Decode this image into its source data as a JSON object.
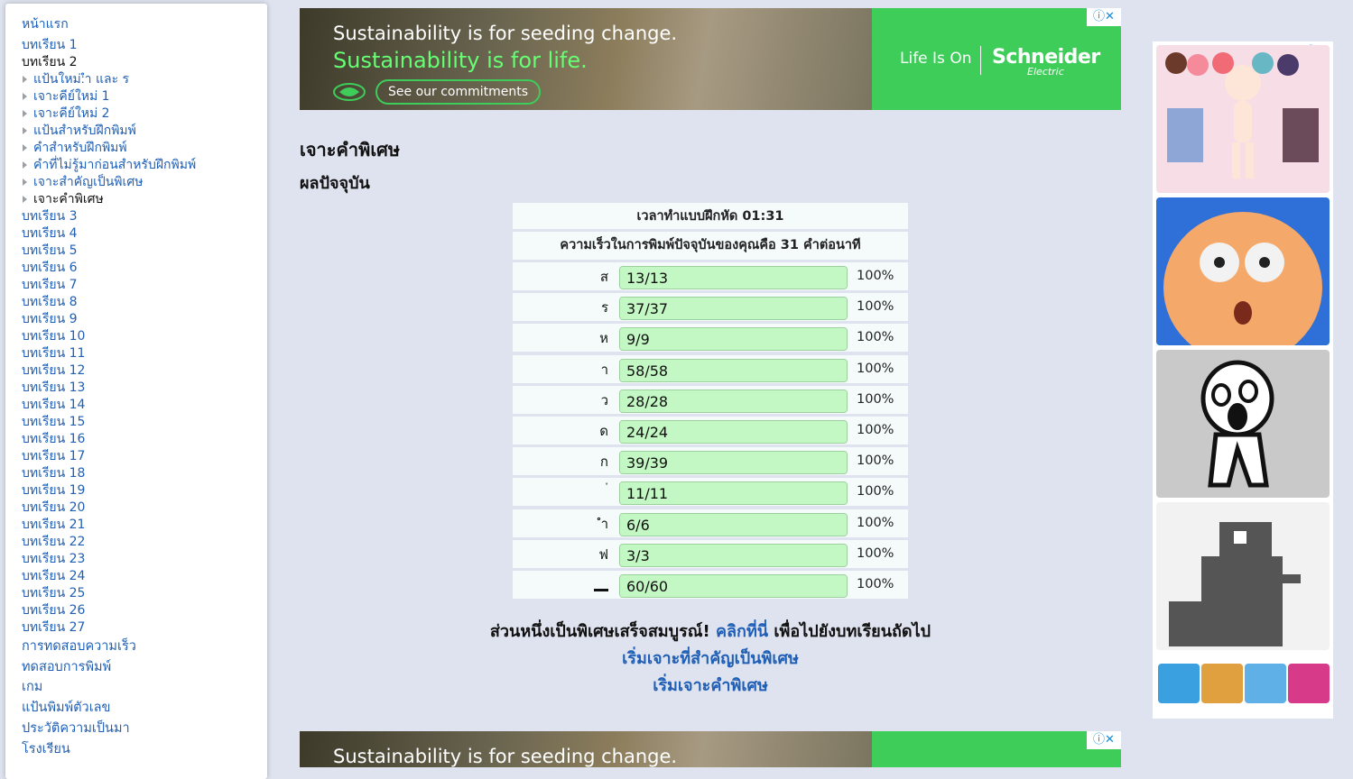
{
  "sidebar": {
    "home": "หน้าแรก",
    "lesson1": "บทเรียน 1",
    "lesson2": "บทเรียน 2",
    "sub_items": [
      "แป้นใหม่:ำ และ ร",
      "เจาะคีย์ใหม่ 1",
      "เจาะคีย์ใหม่ 2",
      "แป้นสำหรับฝึกพิมพ์",
      "คำสำหรับฝึกพิมพ์",
      "คำที่ไม่รู้มาก่อนสำหรับฝึกพิมพ์",
      "เจาะสำคัญเป็นพิเศษ",
      "เจาะคำพิเศษ"
    ],
    "lessons": [
      "บทเรียน 3",
      "บทเรียน 4",
      "บทเรียน 5",
      "บทเรียน 6",
      "บทเรียน 7",
      "บทเรียน 8",
      "บทเรียน 9",
      "บทเรียน 10",
      "บทเรียน 11",
      "บทเรียน 12",
      "บทเรียน 13",
      "บทเรียน 14",
      "บทเรียน 15",
      "บทเรียน 16",
      "บทเรียน 17",
      "บทเรียน 18",
      "บทเรียน 19",
      "บทเรียน 20",
      "บทเรียน 21",
      "บทเรียน 22",
      "บทเรียน 23",
      "บทเรียน 24",
      "บทเรียน 25",
      "บทเรียน 26",
      "บทเรียน 27"
    ],
    "extra": [
      "การทดสอบความเร็ว",
      "ทดสอบการพิมพ์",
      "เกม",
      "แป้นพิมพ์ตัวเลข",
      "ประวัติความเป็นมา",
      "โรงเรียน"
    ]
  },
  "ad_top": {
    "line1": "Sustainability is for seeding change.",
    "line2": "Sustainability is for life.",
    "cta": "See our commitments",
    "tagline": "Life Is On",
    "brand": "Schneider",
    "brand_sub": "Electric",
    "choice": "ⓘ✕"
  },
  "ad_bottom": {
    "line1": "Sustainability is for seeding change.",
    "choice": "ⓘ✕"
  },
  "main": {
    "title": "เจาะคำพิเศษ",
    "subtitle": "ผลปัจจุบัน",
    "time_text": "เวลาทำแบบฝึกหัด 01:31",
    "speed_text": "ความเร็วในการพิมพ์ปัจจุบันของคุณคือ 31 คำต่อนาที",
    "rows": [
      {
        "key": "ส",
        "score": "13/13",
        "pct": "100%",
        "fraction": 1.0
      },
      {
        "key": "ร",
        "score": "37/37",
        "pct": "100%",
        "fraction": 1.0
      },
      {
        "key": "ห",
        "score": "9/9",
        "pct": "100%",
        "fraction": 1.0
      },
      {
        "key": "า",
        "score": "58/58",
        "pct": "100%",
        "fraction": 1.0
      },
      {
        "key": "ว",
        "score": "28/28",
        "pct": "100%",
        "fraction": 1.0
      },
      {
        "key": "ด",
        "score": "24/24",
        "pct": "100%",
        "fraction": 1.0
      },
      {
        "key": "ก",
        "score": "39/39",
        "pct": "100%",
        "fraction": 1.0
      },
      {
        "key": "่",
        "score": "11/11",
        "pct": "100%",
        "fraction": 1.0
      },
      {
        "key": "ำ",
        "score": "6/6",
        "pct": "100%",
        "fraction": 1.0
      },
      {
        "key": "ฟ",
        "score": "3/3",
        "pct": "100%",
        "fraction": 1.0
      },
      {
        "key": "",
        "score": "60/60",
        "pct": "100%",
        "fraction": 1.0
      }
    ],
    "complete_text": "ส่วนหนึ่งเป็นพิเศษเสร็จสมบูรณ์!",
    "click_here": "คลิกที่นี่",
    "next_text": "เพื่อไปยังบทเรียนถัดไป",
    "link_important": "เริ่มเจาะที่สำคัญเป็นพิเศษ",
    "link_words": "เริ่มเจาะคำพิเศษ"
  },
  "colors": {
    "link": "#1f5fb5",
    "bar_fill": "#c3f7c3",
    "page_bg": "#dfe3ef",
    "ad_green": "#3dcd58"
  }
}
